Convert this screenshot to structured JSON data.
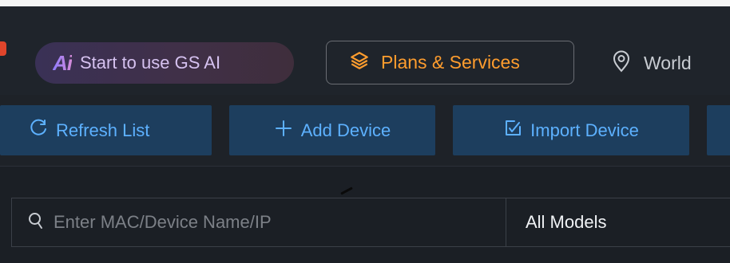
{
  "header": {
    "ai_pill": {
      "logo": "Ai",
      "label": "Start to use GS AI"
    },
    "plans_label": "Plans & Services",
    "world_label": "World",
    "colors": {
      "accent_orange": "#ff9d2e",
      "ai_purple": "#8e7bff"
    },
    "icons": {
      "plans": "layers-icon",
      "world": "location-pin-icon"
    }
  },
  "toolbar": {
    "refresh_label": "Refresh List",
    "add_label": "Add Device",
    "import_label": "Import Device",
    "accent": "#5db1ff",
    "icons": {
      "refresh": "refresh-icon",
      "add": "plus-icon",
      "import": "import-icon"
    }
  },
  "filters": {
    "search_placeholder": "Enter MAC/Device Name/IP",
    "search_value": "",
    "model_selected": "All Models",
    "icons": {
      "search": "search-icon"
    }
  }
}
